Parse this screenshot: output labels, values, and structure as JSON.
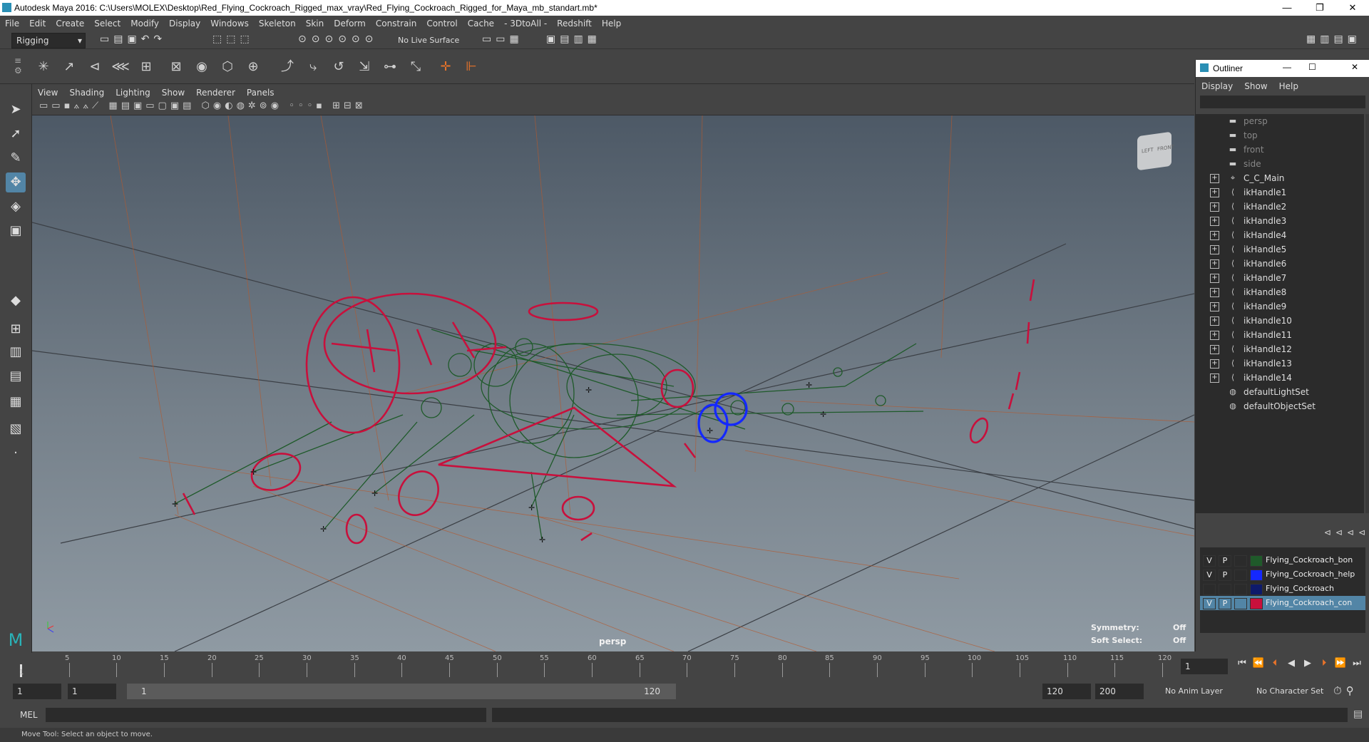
{
  "window": {
    "title": "Autodesk Maya 2016: C:\\Users\\MOLEX\\Desktop\\Red_Flying_Cockroach_Rigged_max_vray\\Red_Flying_Cockroach_Rigged_for_Maya_mb_standart.mb*",
    "minimize": "—",
    "restore": "❐",
    "close": "✕"
  },
  "menu": [
    "File",
    "Edit",
    "Create",
    "Select",
    "Modify",
    "Display",
    "Windows",
    "Skeleton",
    "Skin",
    "Deform",
    "Constrain",
    "Control",
    "Cache",
    "- 3DtoAll -",
    "Redshift",
    "Help"
  ],
  "status": {
    "mode": "Rigging",
    "live_surface": "No Live Surface"
  },
  "panel_menu": [
    "View",
    "Shading",
    "Lighting",
    "Show",
    "Renderer",
    "Panels"
  ],
  "viewport": {
    "camera": "persp",
    "symmetry_label": "Symmetry:",
    "symmetry_value": "Off",
    "soft_select_label": "Soft Select:",
    "soft_select_value": "Off",
    "viewcube_left": "LEFT",
    "viewcube_front": "FRONT",
    "colors": {
      "joint": "#1f5a2a",
      "control": "#c8103c",
      "helper": "#1428ff",
      "grid": "#3b3f45",
      "line": "#b4592e"
    }
  },
  "outliner": {
    "title": "Outliner",
    "menu": [
      "Display",
      "Show",
      "Help"
    ],
    "items": [
      {
        "label": "persp",
        "kind": "camera",
        "dim": true
      },
      {
        "label": "top",
        "kind": "camera",
        "dim": true
      },
      {
        "label": "front",
        "kind": "camera",
        "dim": true
      },
      {
        "label": "side",
        "kind": "camera",
        "dim": true
      },
      {
        "label": "C_C_Main",
        "kind": "transform"
      },
      {
        "label": "ikHandle1",
        "kind": "ik"
      },
      {
        "label": "ikHandle2",
        "kind": "ik"
      },
      {
        "label": "ikHandle3",
        "kind": "ik"
      },
      {
        "label": "ikHandle4",
        "kind": "ik"
      },
      {
        "label": "ikHandle5",
        "kind": "ik"
      },
      {
        "label": "ikHandle6",
        "kind": "ik"
      },
      {
        "label": "ikHandle7",
        "kind": "ik"
      },
      {
        "label": "ikHandle8",
        "kind": "ik"
      },
      {
        "label": "ikHandle9",
        "kind": "ik"
      },
      {
        "label": "ikHandle10",
        "kind": "ik"
      },
      {
        "label": "ikHandle11",
        "kind": "ik"
      },
      {
        "label": "ikHandle12",
        "kind": "ik"
      },
      {
        "label": "ikHandle13",
        "kind": "ik"
      },
      {
        "label": "ikHandle14",
        "kind": "ik"
      },
      {
        "label": "defaultLightSet",
        "kind": "set"
      },
      {
        "label": "defaultObjectSet",
        "kind": "set"
      }
    ]
  },
  "layers": [
    {
      "v": "V",
      "p": "P",
      "name": "Flying_Cockroach_bon",
      "color": "#1f5a2a"
    },
    {
      "v": "V",
      "p": "P",
      "name": "Flying_Cockroach_help",
      "color": "#1428ff"
    },
    {
      "v": "",
      "p": "",
      "name": "Flying_Cockroach",
      "color": "#0e1a6b"
    },
    {
      "v": "V",
      "p": "P",
      "name": "Flying_Cockroach_con",
      "color": "#c8103c",
      "selected": true
    }
  ],
  "timeline": {
    "ticks": [
      "5",
      "10",
      "15",
      "20",
      "25",
      "30",
      "35",
      "40",
      "45",
      "50",
      "55",
      "60",
      "65",
      "70",
      "75",
      "80",
      "85",
      "90",
      "95",
      "100",
      "105",
      "110",
      "115",
      "120"
    ],
    "start_tick": "1",
    "current_frame": "1"
  },
  "range": {
    "start": "1",
    "anim_start": "1",
    "slider_start": "1",
    "slider_end": "120",
    "anim_end": "120",
    "end": "200",
    "anim_layer": "No Anim Layer",
    "character_set": "No Character Set"
  },
  "cmd": {
    "label": "MEL"
  },
  "help_line": "Move Tool: Select an object to move."
}
